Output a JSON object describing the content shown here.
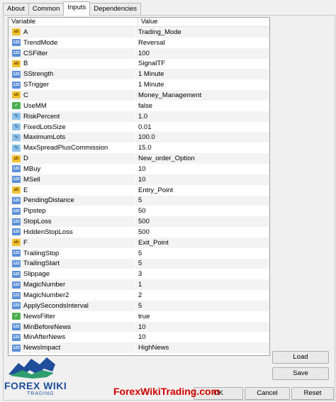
{
  "tabs": [
    "About",
    "Common",
    "Inputs",
    "Dependencies"
  ],
  "active_tab": "Inputs",
  "columns": [
    "Variable",
    "Value"
  ],
  "rows": [
    {
      "icon": "ab",
      "variable": "A",
      "value": "Trading_Mode"
    },
    {
      "icon": "123",
      "variable": "TrendMode",
      "value": "Reversal"
    },
    {
      "icon": "123",
      "variable": "CSFilter",
      "value": "100"
    },
    {
      "icon": "ab",
      "variable": "B",
      "value": "SignalTF"
    },
    {
      "icon": "123",
      "variable": "SStrength",
      "value": "1 Minute"
    },
    {
      "icon": "123",
      "variable": "STrigger",
      "value": "1 Minute"
    },
    {
      "icon": "ab",
      "variable": "C",
      "value": "Money_Management"
    },
    {
      "icon": "bool",
      "variable": "UseMM",
      "value": "false"
    },
    {
      "icon": "half",
      "variable": "RiskPercent",
      "value": "1.0"
    },
    {
      "icon": "half",
      "variable": "FixedLotsSize",
      "value": "0.01"
    },
    {
      "icon": "half",
      "variable": "MaximumLots",
      "value": "100.0"
    },
    {
      "icon": "half",
      "variable": "MaxSpreadPlusCommission",
      "value": "15.0"
    },
    {
      "icon": "ab",
      "variable": "D",
      "value": "New_order_Option"
    },
    {
      "icon": "123",
      "variable": "MBuy",
      "value": "10"
    },
    {
      "icon": "123",
      "variable": "MSell",
      "value": "10"
    },
    {
      "icon": "ab",
      "variable": "E",
      "value": "Entry_Point"
    },
    {
      "icon": "123",
      "variable": "PendingDistance",
      "value": "5"
    },
    {
      "icon": "123",
      "variable": "Pipstep",
      "value": "50"
    },
    {
      "icon": "123",
      "variable": "StopLoss",
      "value": "500"
    },
    {
      "icon": "123",
      "variable": "HiddenStopLoss",
      "value": "500"
    },
    {
      "icon": "ab",
      "variable": "F",
      "value": "Exit_Point"
    },
    {
      "icon": "123",
      "variable": "TrailingStop",
      "value": "5"
    },
    {
      "icon": "123",
      "variable": "TrailingStart",
      "value": "5"
    },
    {
      "icon": "123",
      "variable": "Slippage",
      "value": "3"
    },
    {
      "icon": "123",
      "variable": "MagicNumber",
      "value": "1"
    },
    {
      "icon": "123",
      "variable": "MagicNumber2",
      "value": "2"
    },
    {
      "icon": "123",
      "variable": "ApplySecondsInterval",
      "value": "5"
    },
    {
      "icon": "bool",
      "variable": "NewsFilter",
      "value": "true"
    },
    {
      "icon": "123",
      "variable": "MinBeforeNews",
      "value": "10"
    },
    {
      "icon": "123",
      "variable": "MinAfterNews",
      "value": "10"
    },
    {
      "icon": "123",
      "variable": "NewsImpact",
      "value": "HighNews"
    }
  ],
  "buttons": {
    "load": "Load",
    "save": "Save",
    "ok": "OK",
    "cancel": "Cancel",
    "reset": "Reset"
  },
  "logo": {
    "brand_top": "FOREX WIKI",
    "brand_bottom": "TRADING"
  },
  "watermark": "ForexWikiTrading.com",
  "colors": {
    "accent": "#1f4e9a",
    "watermark": "#d40000"
  }
}
